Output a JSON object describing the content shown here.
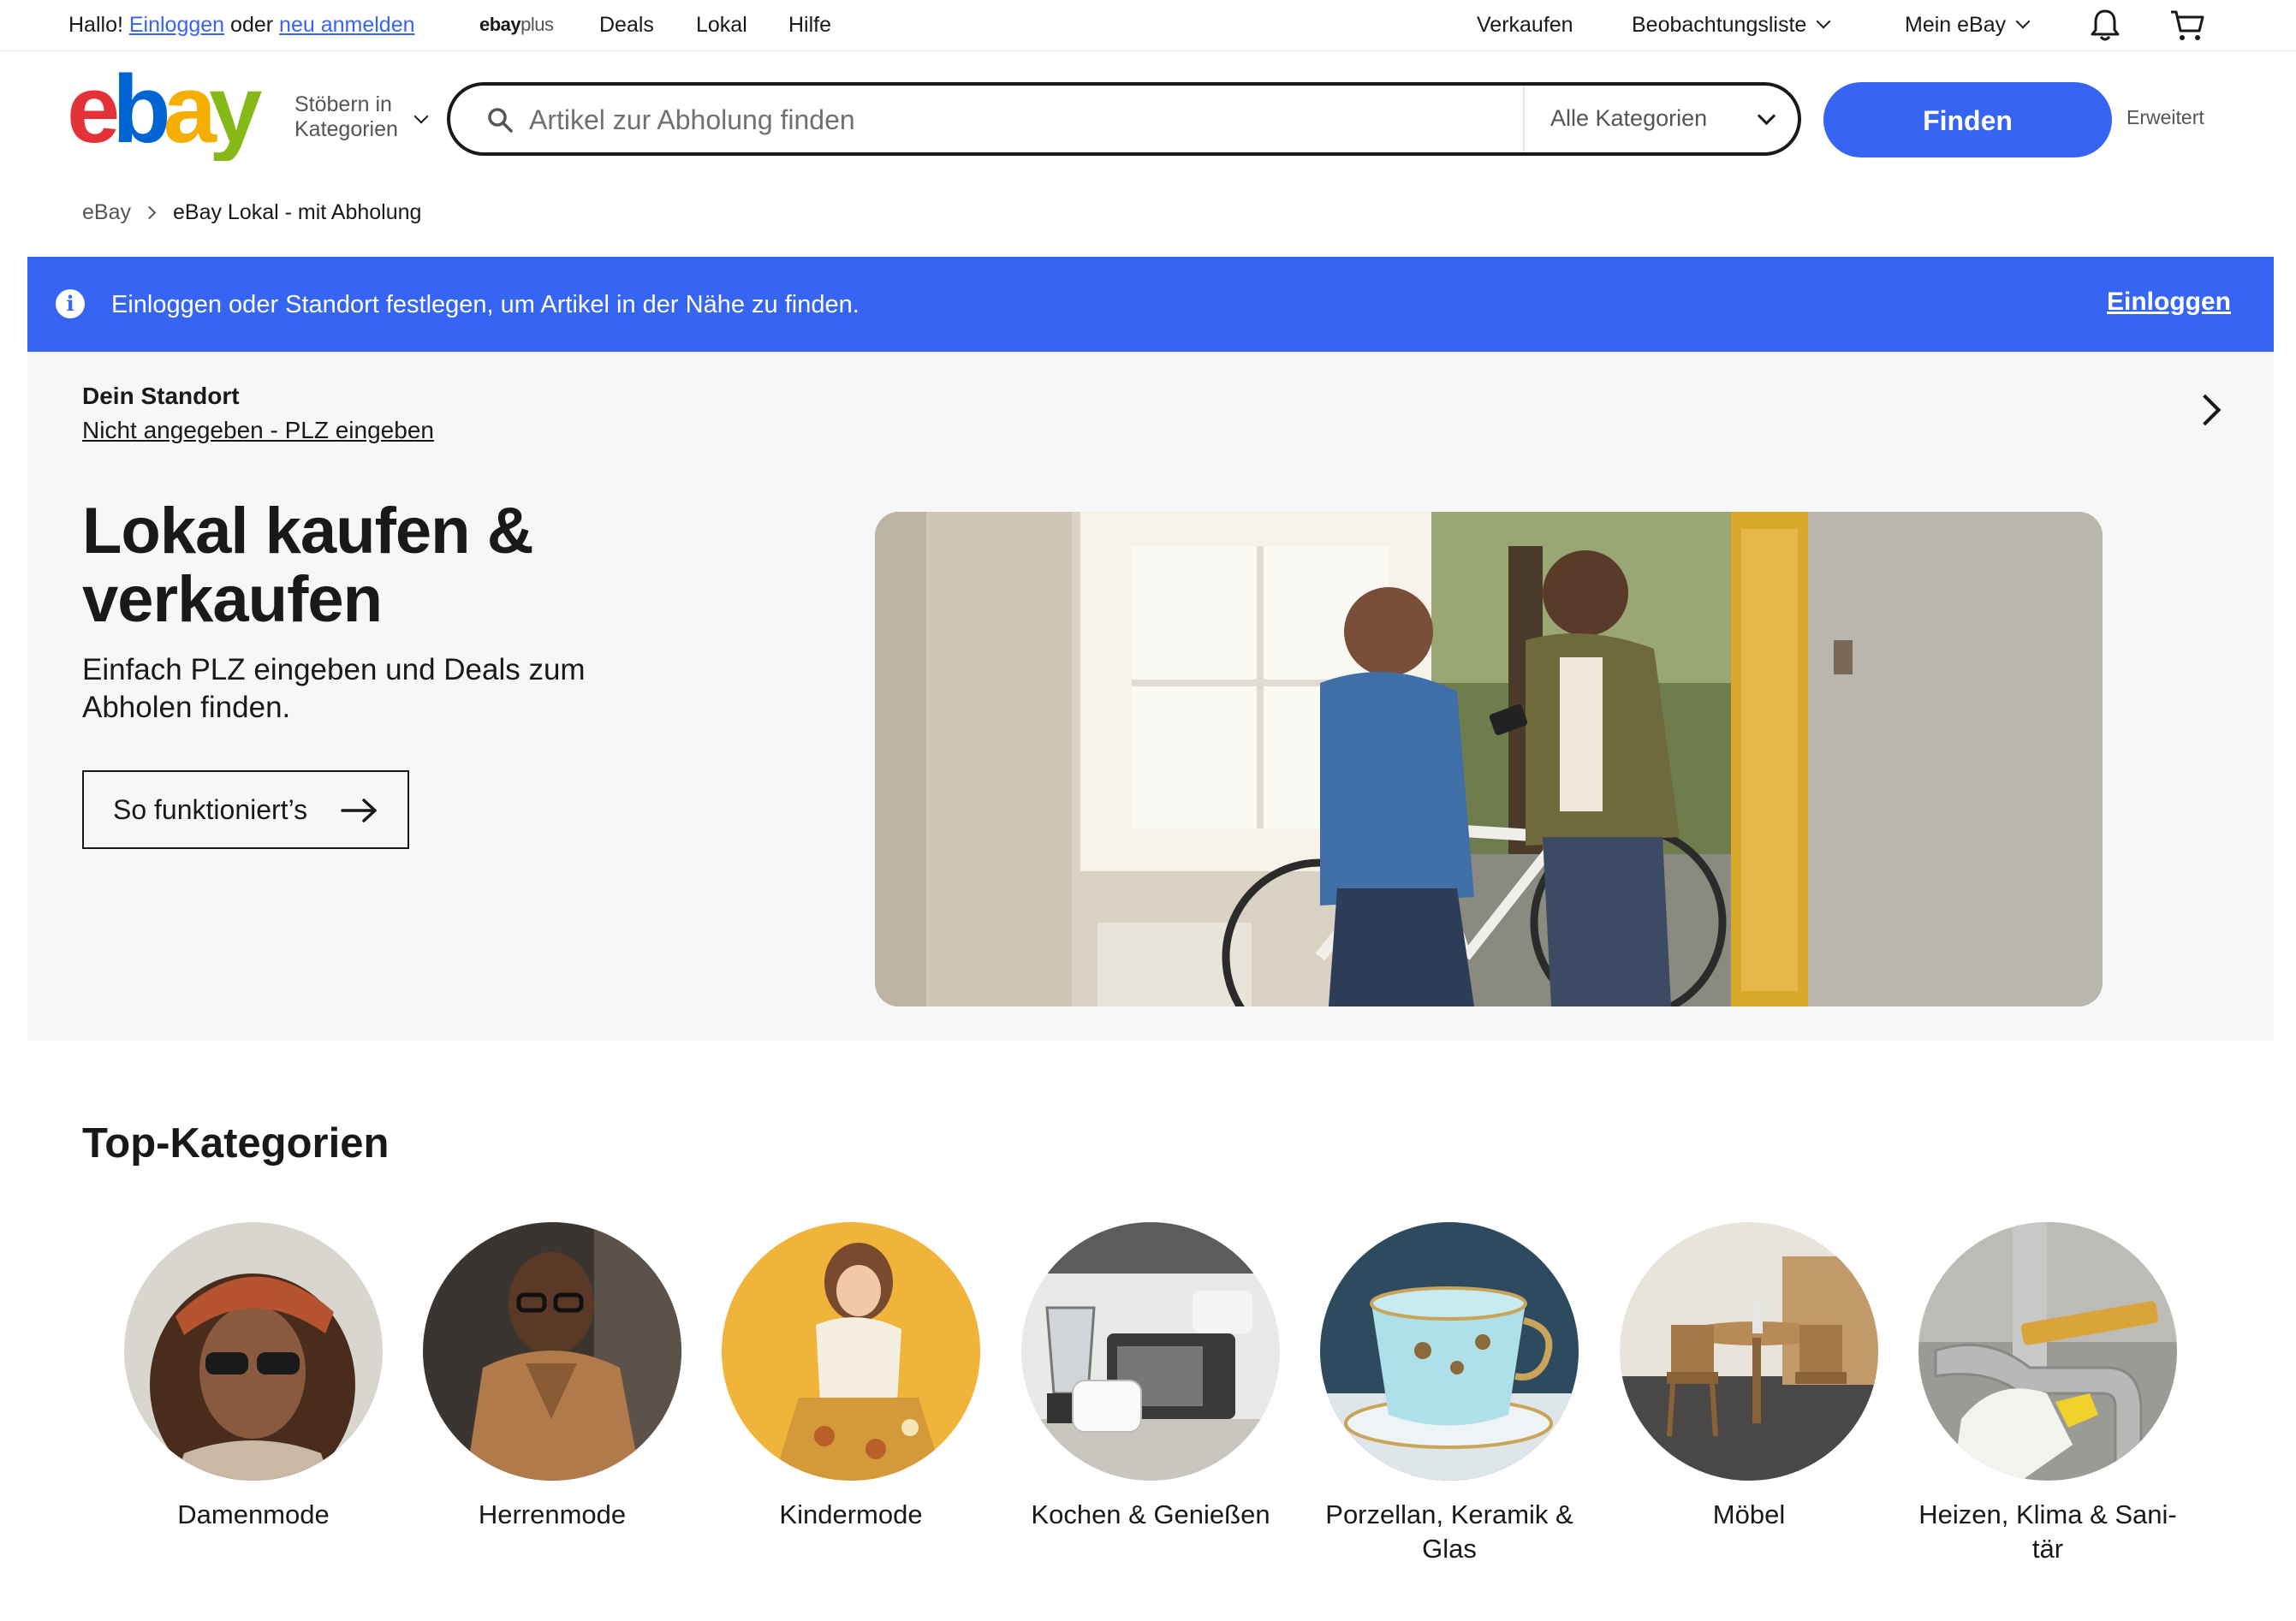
{
  "topbar": {
    "greeting": "Hallo!",
    "login_link": "Einloggen",
    "or_text": "oder",
    "register_link": "neu anmelden",
    "plus_ebay": "ebay",
    "plus_word": "plus",
    "nav": [
      "Deals",
      "Lokal",
      "Hilfe"
    ],
    "sell": "Verkaufen",
    "watchlist": "Beobachtungsliste",
    "my_ebay": "Mein eBay"
  },
  "header": {
    "browse_label": "Stöbern in Kategorien",
    "search_placeholder": "Artikel zur Abholung finden",
    "category_select": "Alle Kategorien",
    "search_button": "Finden",
    "advanced": "Erweitert"
  },
  "breadcrumb": [
    "eBay",
    "eBay Lokal - mit Abholung"
  ],
  "banner": {
    "message": "Einloggen oder Standort festlegen, um Artikel in der Nähe zu finden.",
    "action": "Einloggen"
  },
  "location": {
    "label": "Dein Standort",
    "value": "Nicht angegeben - PLZ eingeben"
  },
  "hero": {
    "title": "Lokal kaufen & verkaufen",
    "subtitle": "Einfach PLZ eingeben und Deals zum Abholen finden.",
    "button": "So funktioniert’s"
  },
  "top_categories": {
    "title": "Top-Kategorien",
    "items": [
      "Damenmode",
      "Herrenmode",
      "Kindermode",
      "Kochen & Genießen",
      "Porzellan, Keramik & Glas",
      "Möbel",
      "Heizen, Klima & Sani- tär"
    ]
  },
  "colors": {
    "accent": "#3665f3",
    "text": "#191919",
    "hero_bg": "#f7f7f7",
    "logo_red": "#e53238",
    "logo_blue": "#0064d2",
    "logo_yellow": "#f5af02",
    "logo_green": "#86b817"
  }
}
